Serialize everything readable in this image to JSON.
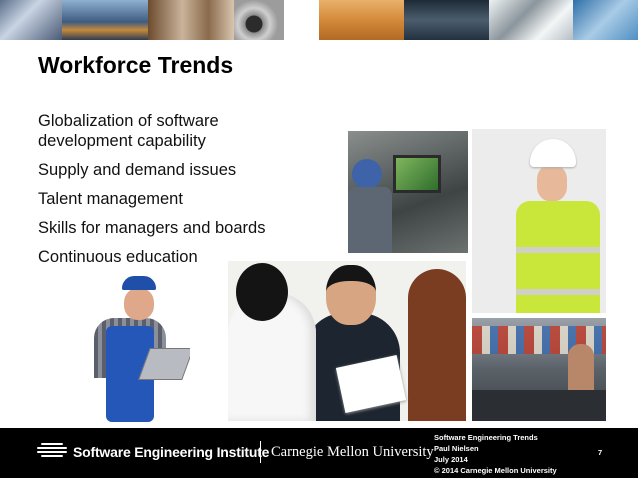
{
  "slide": {
    "title": "Workforce Trends",
    "bullets": [
      "Globalization of software development capability",
      "Supply and demand issues",
      "Talent management",
      "Skills for managers and boards",
      "Continuous education"
    ]
  },
  "footer": {
    "institute": "Software Engineering Institute",
    "university": "Carnegie Mellon University",
    "presentation_title": "Software Engineering Trends",
    "author": "Paul Nielsen",
    "date": "July 2014",
    "copyright": "© 2014 Carnegie Mellon University",
    "page_number": "7"
  },
  "colors": {
    "footer_background": "#000000",
    "title_text": "#000000",
    "slide_background": "#ffffff"
  }
}
